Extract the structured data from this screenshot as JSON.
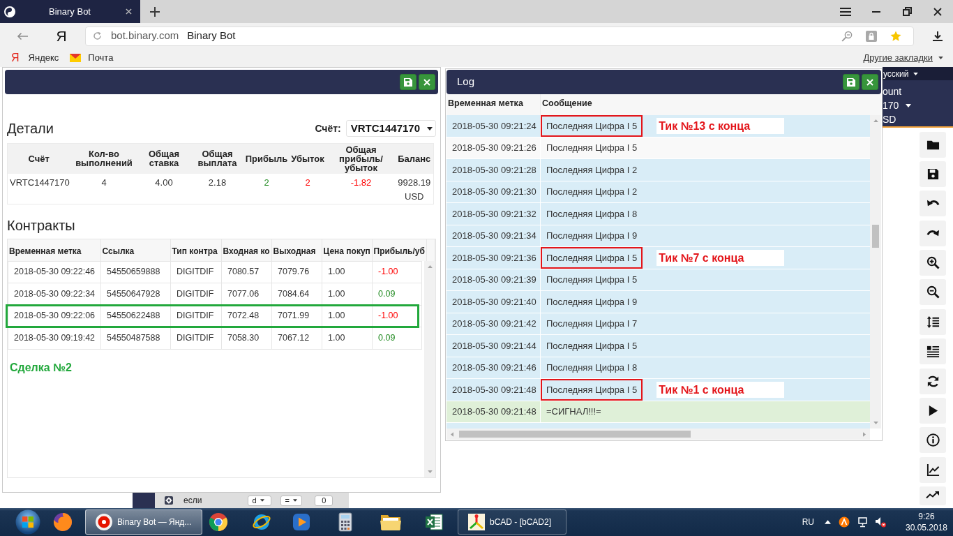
{
  "browser": {
    "tab": {
      "title": "Binary Bot",
      "selected": true
    },
    "logo": "Я",
    "address": {
      "domain": "bot.binary.com",
      "page_title": "Binary Bot"
    },
    "bookmarks": [
      {
        "kind": "letter",
        "favicon_text": "Я",
        "label": "Яндекс"
      },
      {
        "kind": "mail",
        "label": "Почта"
      }
    ],
    "other_bookmarks": "Другие закладки"
  },
  "app_header": {
    "language": "усский",
    "account_label": "ount",
    "account": "170",
    "currency": "SD"
  },
  "summary_panel": {
    "details_title": "Детали",
    "account_label": "Счёт:",
    "account": "VRTC1447170",
    "details_table": {
      "columns": [
        "Счёт",
        "Кол-во выполнений",
        "Общая ставка",
        "Общая выплата",
        "Прибыль",
        "Убыток",
        "Общая прибыль/убыток",
        "Баланс"
      ],
      "rows": [
        {
          "cells": [
            {
              "text": "VRTC1447170"
            },
            {
              "text": "4"
            },
            {
              "text": "4.00"
            },
            {
              "text": "2.18"
            },
            {
              "text": "2",
              "color": "#228b22"
            },
            {
              "text": "2",
              "color": "#ff0000"
            },
            {
              "text": "-1.82",
              "color": "#ff0000"
            },
            {
              "text": "9928.19 USD"
            }
          ]
        }
      ]
    },
    "contracts_title": "Контракты",
    "contracts_table": {
      "columns": [
        "Временная метка",
        "Ссылка",
        "Тип контра",
        "Входная ко",
        "Выходная",
        "Цена покуп",
        "Прибыль/уб"
      ],
      "rows": [
        {
          "cells": [
            "2018-05-30 09:22:46",
            "54550659888",
            "DIGITDIF",
            "7080.57",
            "7079.76",
            "1.00"
          ],
          "profit": "-1.00",
          "color": "#ff0000",
          "highlighted": false
        },
        {
          "cells": [
            "2018-05-30 09:22:34",
            "54550647928",
            "DIGITDIF",
            "7077.06",
            "7084.64",
            "1.00"
          ],
          "profit": "0.09",
          "color": "#228b22",
          "highlighted": false
        },
        {
          "cells": [
            "2018-05-30 09:22:06",
            "54550622488",
            "DIGITDIF",
            "7072.48",
            "7071.99",
            "1.00"
          ],
          "profit": "-1.00",
          "color": "#ff0000",
          "highlighted": true
        },
        {
          "cells": [
            "2018-05-30 09:19:42",
            "54550487588",
            "DIGITDIF",
            "7058.30",
            "7067.12",
            "1.00"
          ],
          "profit": "0.09",
          "color": "#228b22",
          "highlighted": false
        }
      ]
    },
    "annotation": "Сделка №2"
  },
  "log_panel": {
    "title": "Log",
    "columns": [
      "Временная метка",
      "Сообщение"
    ],
    "rows": [
      {
        "time": "2018-05-30 09:21:24",
        "message": "Последняя Цифра I 5",
        "kind": "info",
        "marked": true,
        "note": "Тик №13 с конца"
      },
      {
        "time": "2018-05-30 09:21:26",
        "message": "Последняя Цифра I 5",
        "kind": "plain",
        "marked": false
      },
      {
        "time": "2018-05-30 09:21:28",
        "message": "Последняя Цифра I 2",
        "kind": "info",
        "marked": false
      },
      {
        "time": "2018-05-30 09:21:30",
        "message": "Последняя Цифра I 2",
        "kind": "info",
        "marked": false
      },
      {
        "time": "2018-05-30 09:21:32",
        "message": "Последняя Цифра I 8",
        "kind": "info",
        "marked": false
      },
      {
        "time": "2018-05-30 09:21:34",
        "message": "Последняя Цифра I 9",
        "kind": "info",
        "marked": false
      },
      {
        "time": "2018-05-30 09:21:36",
        "message": "Последняя Цифра I 5",
        "kind": "info",
        "marked": true,
        "note": "Тик №7 с конца"
      },
      {
        "time": "2018-05-30 09:21:39",
        "message": "Последняя Цифра I 5",
        "kind": "info",
        "marked": false
      },
      {
        "time": "2018-05-30 09:21:40",
        "message": "Последняя Цифра I 9",
        "kind": "info",
        "marked": false
      },
      {
        "time": "2018-05-30 09:21:42",
        "message": "Последняя Цифра I 7",
        "kind": "info",
        "marked": false
      },
      {
        "time": "2018-05-30 09:21:44",
        "message": "Последняя Цифра I 5",
        "kind": "info",
        "marked": false
      },
      {
        "time": "2018-05-30 09:21:46",
        "message": "Последняя Цифра I 8",
        "kind": "info",
        "marked": false
      },
      {
        "time": "2018-05-30 09:21:48",
        "message": "Последняя Цифра I 5",
        "kind": "info",
        "marked": true,
        "note": "Тик №1 с конца"
      },
      {
        "time": "2018-05-30 09:21:48",
        "message": "=СИГНАЛ!!!=",
        "kind": "success",
        "marked": false
      }
    ]
  },
  "workspace_block": {
    "label": "если",
    "fields": [
      {
        "kind": "dropdown",
        "text": "d"
      },
      {
        "kind": "dropdown",
        "text": "="
      },
      {
        "kind": "input",
        "text": "0"
      }
    ]
  },
  "taskbar": {
    "windows": [
      {
        "label": "Binary Bot — Янд...",
        "selected": true
      },
      {
        "label": "bCAD - [bCAD2]",
        "selected": false
      }
    ],
    "language": "RU",
    "time": "9:26",
    "date": "30.05.2018"
  }
}
